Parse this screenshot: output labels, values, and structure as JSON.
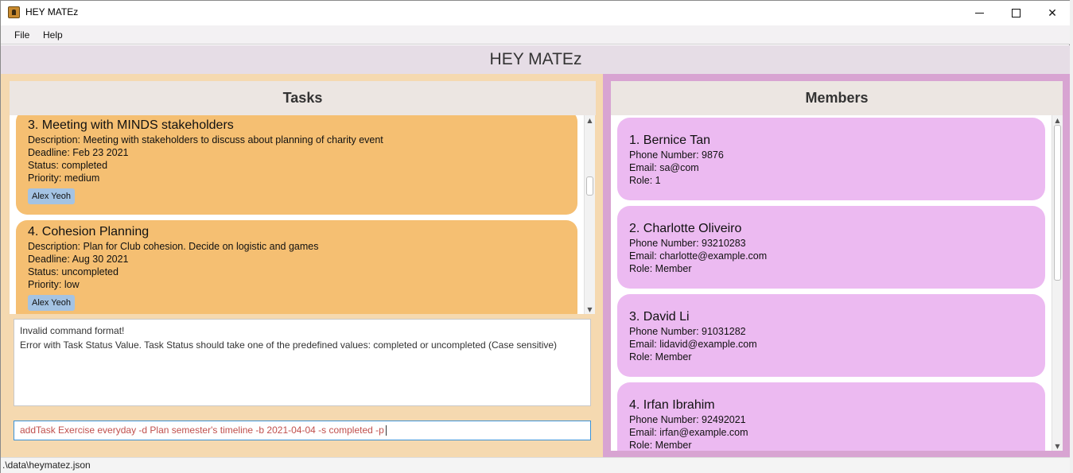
{
  "window": {
    "title": "HEY MATEz",
    "minimize_icon": "minimize-icon",
    "maximize_icon": "maximize-icon",
    "close_icon": "close-icon",
    "close_glyph": "✕"
  },
  "menu": {
    "items": [
      {
        "label": "File"
      },
      {
        "label": "Help"
      }
    ]
  },
  "header": {
    "title": "HEY MATEz"
  },
  "tasks": {
    "heading": "Tasks",
    "items": [
      {
        "title": "3.  Meeting with MINDS stakeholders",
        "description": "Description: Meeting with stakeholders to discuss about planning of charity event",
        "deadline": "Deadline: Feb 23 2021",
        "status": "Status: completed",
        "priority": "Priority: medium",
        "tag": "Alex Yeoh"
      },
      {
        "title": "4.  Cohesion Planning",
        "description": "Description: Plan for Club cohesion. Decide on logistic and games",
        "deadline": "Deadline: Aug 30 2021",
        "status": "Status: uncompleted",
        "priority": "Priority: low",
        "tag": "Alex Yeoh"
      }
    ]
  },
  "members": {
    "heading": "Members",
    "items": [
      {
        "title": "1.  Bernice Tan",
        "phone": "Phone Number: 9876",
        "email": "Email: sa@com",
        "role": "Role: 1"
      },
      {
        "title": "2.  Charlotte Oliveiro",
        "phone": "Phone Number: 93210283",
        "email": "Email: charlotte@example.com",
        "role": "Role: Member"
      },
      {
        "title": "3.  David Li",
        "phone": "Phone Number: 91031282",
        "email": "Email: lidavid@example.com",
        "role": "Role: Member"
      },
      {
        "title": "4.  Irfan Ibrahim",
        "phone": "Phone Number: 92492021",
        "email": "Email: irfan@example.com",
        "role": "Role: Member"
      }
    ]
  },
  "result": {
    "line1": "Invalid command format!",
    "line2": "Error with Task Status Value. Task Status should take one of the predefined values: completed or uncompleted (Case sensitive)"
  },
  "command": {
    "value": "addTask Exercise everyday -d Plan semester's timeline -b 2021-04-04 -s completed -p"
  },
  "status_bar": {
    "path": ".\\data\\heymatez.json"
  },
  "scroll": {
    "up_glyph": "▲",
    "down_glyph": "▼"
  },
  "colors": {
    "task_card": "#f5bf72",
    "member_card": "#ecbaf1",
    "tag": "#a4c3e3",
    "left_panel": "#f5d9b0",
    "right_panel": "#d8a4d2",
    "command_text": "#c0504d"
  }
}
